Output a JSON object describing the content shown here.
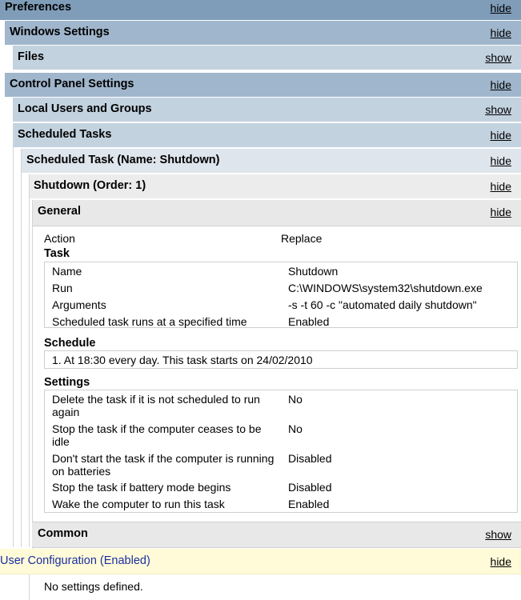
{
  "links": {
    "hide": "hide",
    "show": "show"
  },
  "headers": {
    "preferences": "Preferences",
    "windows_settings": "Windows Settings",
    "files": "Files",
    "control_panel": "Control Panel Settings",
    "local_users": "Local Users and Groups",
    "scheduled_tasks": "Scheduled Tasks",
    "scheduled_task": "Scheduled Task (Name: Shutdown)",
    "shutdown": "Shutdown (Order: 1)",
    "general": "General",
    "common": "Common",
    "user_config": "User Configuration (Enabled)"
  },
  "general": {
    "action_label": "Action",
    "action_value": "Replace",
    "task_title": "Task",
    "task_rows": [
      {
        "label": "Name",
        "value": "Shutdown"
      },
      {
        "label": "Run",
        "value": "C:\\WINDOWS\\system32\\shutdown.exe"
      },
      {
        "label": "Arguments",
        "value": "-s -t 60 -c \"automated daily shutdown\""
      },
      {
        "label": "Scheduled task runs at a specified time",
        "value": "Enabled"
      }
    ],
    "schedule_title": "Schedule",
    "schedule_text": "1. At 18:30 every day. This task starts on 24/02/2010",
    "settings_title": "Settings",
    "settings_rows": [
      {
        "label": "Delete the task if it is not scheduled to run again",
        "value": "No"
      },
      {
        "label": "Stop the task if the computer ceases to be idle",
        "value": "No"
      },
      {
        "label": "Don't start the task if the computer is running on batteries",
        "value": "Disabled"
      },
      {
        "label": "Stop the task if battery mode begins",
        "value": "Disabled"
      },
      {
        "label": "Wake the computer to run this task",
        "value": "Enabled"
      }
    ]
  },
  "user_config": {
    "no_settings": "No settings defined."
  }
}
